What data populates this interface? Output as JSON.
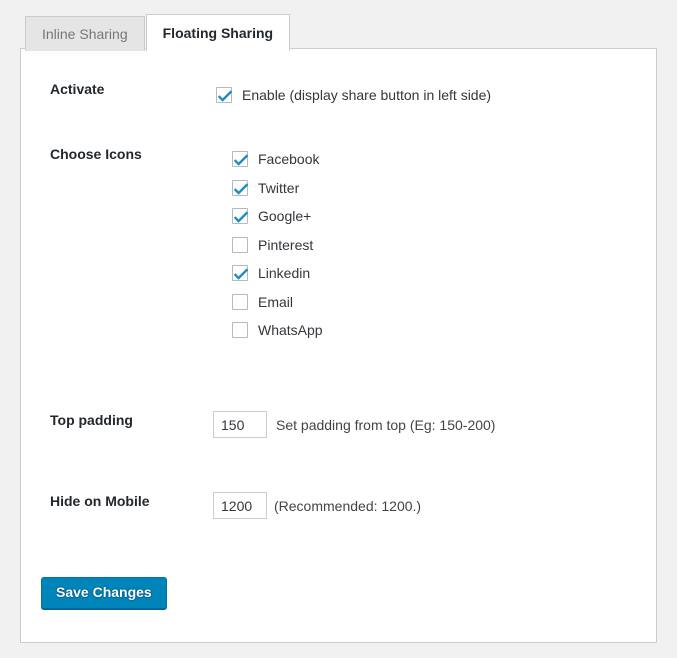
{
  "tabs": [
    {
      "id": "inline-sharing",
      "label": "Inline Sharing",
      "active": false
    },
    {
      "id": "floating-sharing",
      "label": "Floating Sharing",
      "active": true
    }
  ],
  "form": {
    "activate": {
      "label": "Activate",
      "option": {
        "label": "Enable (display share button in left side)",
        "checked": true
      }
    },
    "choose_icons": {
      "label": "Choose Icons",
      "items": [
        {
          "label": "Facebook",
          "checked": true
        },
        {
          "label": "Twitter",
          "checked": true
        },
        {
          "label": "Google+",
          "checked": true
        },
        {
          "label": "Pinterest",
          "checked": false
        },
        {
          "label": "Linkedin",
          "checked": true
        },
        {
          "label": "Email",
          "checked": false
        },
        {
          "label": "WhatsApp",
          "checked": false
        }
      ]
    },
    "top_padding": {
      "label": "Top padding",
      "value": "150",
      "hint": "Set padding from top (Eg: 150-200)"
    },
    "hide_on_mobile": {
      "label": "Hide on Mobile",
      "value": "1200",
      "hint": "(Recommended: 1200.)"
    },
    "save_label": "Save Changes"
  },
  "colors": {
    "page_background": "#f1f1f1",
    "panel_background": "#ffffff",
    "border": "#cccccc",
    "tab_inactive_background": "#e5e5e5",
    "primary_button": "#0085ba",
    "checkmark": "#1e8cbe",
    "label_text": "#23282d",
    "hint_text": "#444444"
  }
}
